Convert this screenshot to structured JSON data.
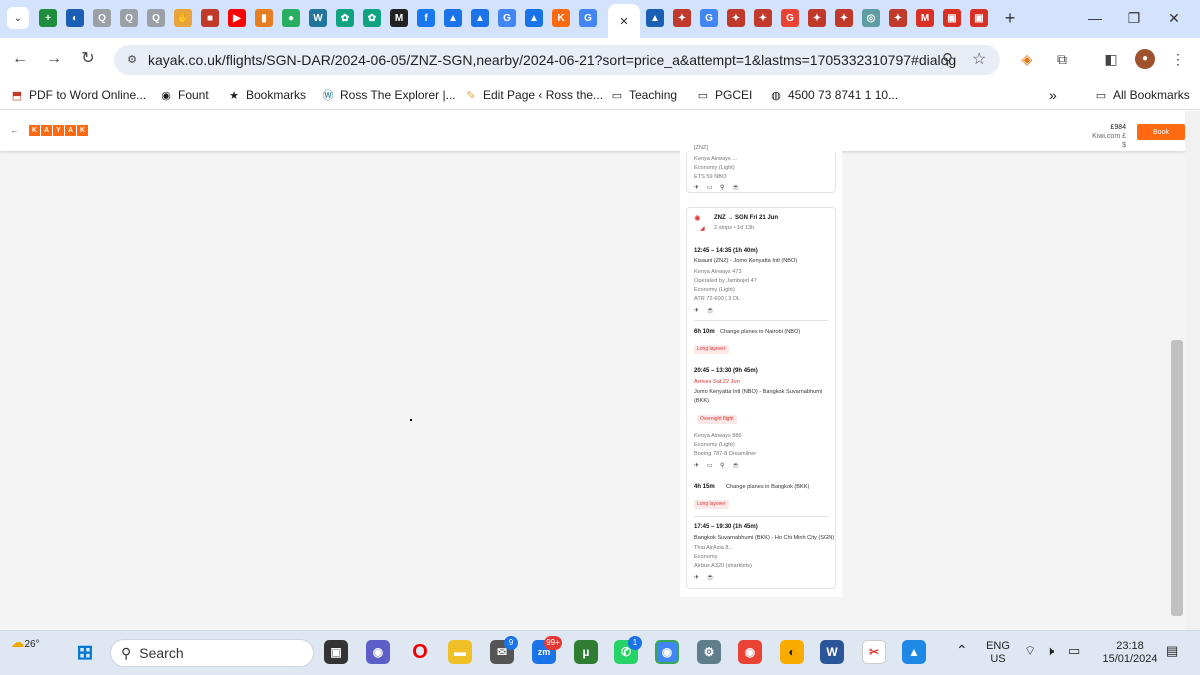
{
  "browser": {
    "active_tab_close": "×",
    "new_tab": "+",
    "url": "kayak.co.uk/flights/SGN-DAR/2024-06-05/ZNZ-SGN,nearby/2024-06-21?sort=price_a&attempt=1&lastms=1705332310797#dialog",
    "tabs": [
      {
        "icon": "sheets-icon",
        "color": "#1e8e3e",
        "glyph": "+"
      },
      {
        "icon": "globe-icon",
        "color": "#1a5fb4",
        "glyph": "◐"
      },
      {
        "icon": "search-icon",
        "color": "#9aa0a6",
        "glyph": "Q"
      },
      {
        "icon": "search-icon",
        "color": "#9aa0a6",
        "glyph": "Q"
      },
      {
        "icon": "search-icon",
        "color": "#9aa0a6",
        "glyph": "Q"
      },
      {
        "icon": "hand-icon",
        "color": "#e8a33d",
        "glyph": "✋"
      },
      {
        "icon": "clapper-icon",
        "color": "#c0392b",
        "glyph": "■"
      },
      {
        "icon": "youtube-icon",
        "color": "#ff0000",
        "glyph": "▶"
      },
      {
        "icon": "bookmark-icon",
        "color": "#e67e22",
        "glyph": "▮"
      },
      {
        "icon": "chat-icon",
        "color": "#27ae60",
        "glyph": "●"
      },
      {
        "icon": "wordpress-icon",
        "color": "#21759b",
        "glyph": "W"
      },
      {
        "icon": "openai-icon",
        "color": "#10a37f",
        "glyph": "✿"
      },
      {
        "icon": "openai-icon",
        "color": "#10a37f",
        "glyph": "✿"
      },
      {
        "icon": "mm-icon",
        "color": "#222222",
        "glyph": "M"
      },
      {
        "icon": "facebook-icon",
        "color": "#1877f2",
        "glyph": "f"
      },
      {
        "icon": "image-icon",
        "color": "#1a73e8",
        "glyph": "▲"
      },
      {
        "icon": "image-icon",
        "color": "#1a73e8",
        "glyph": "▲"
      },
      {
        "icon": "g-icon",
        "color": "#4285f4",
        "glyph": "G"
      },
      {
        "icon": "image-icon",
        "color": "#1a73e8",
        "glyph": "▲"
      },
      {
        "icon": "kayak-icon",
        "color": "#ff690f",
        "glyph": "K"
      },
      {
        "icon": "g-icon",
        "color": "#4285f4",
        "glyph": "G"
      }
    ],
    "tabs_right": [
      {
        "icon": "sail-icon",
        "color": "#1a5fb4",
        "glyph": "▲"
      },
      {
        "icon": "cluster-icon",
        "color": "#c0392b",
        "glyph": "✦"
      },
      {
        "icon": "g-icon",
        "color": "#4285f4",
        "glyph": "G"
      },
      {
        "icon": "cluster-icon",
        "color": "#c0392b",
        "glyph": "✦"
      },
      {
        "icon": "cluster-icon",
        "color": "#c0392b",
        "glyph": "✦"
      },
      {
        "icon": "google-icon",
        "color": "#ea4335",
        "glyph": "G"
      },
      {
        "icon": "cluster-icon",
        "color": "#c0392b",
        "glyph": "✦"
      },
      {
        "icon": "cluster-icon",
        "color": "#c0392b",
        "glyph": "✦"
      },
      {
        "icon": "spiral-icon",
        "color": "#5f9ea0",
        "glyph": "◎"
      },
      {
        "icon": "cluster-icon",
        "color": "#c0392b",
        "glyph": "✦"
      },
      {
        "icon": "gmail-icon",
        "color": "#d93025",
        "glyph": "M"
      },
      {
        "icon": "document-icon",
        "color": "#d93025",
        "glyph": "▣"
      },
      {
        "icon": "document-icon",
        "color": "#d93025",
        "glyph": "▣"
      }
    ],
    "bookmarks": [
      {
        "label": "PDF to Word Online...",
        "icon": "pdf-icon"
      },
      {
        "label": "Fount",
        "icon": "fount-icon"
      },
      {
        "label": "Bookmarks",
        "icon": "star-icon"
      },
      {
        "label": "Ross The Explorer |...",
        "icon": "wordpress-icon"
      },
      {
        "label": "Edit Page ‹ Ross the...",
        "icon": "pen-icon"
      },
      {
        "label": "Teaching",
        "icon": "folder-icon"
      },
      {
        "label": "PGCEI",
        "icon": "folder-icon"
      },
      {
        "label": "4500 73 8741 1 10...",
        "icon": "globe-icon"
      }
    ],
    "bookmarks_more": "»",
    "all_bookmarks": "All Bookmarks"
  },
  "kayak": {
    "price": "£984",
    "price_sub": "Kiwi.com £$",
    "book": "Book",
    "card": {
      "prev_lines": [
        "[ZNZ]",
        "Kenya Airways ...",
        "Economy (Light)",
        "ETS 59 NBO"
      ],
      "segment_title": "ZNZ → SGN  Fri 21 Jun",
      "segment_sub": "2 stops • 1d 13h",
      "leg1_time": "12:45 – 14:35 (1h 40m)",
      "leg1_route": "Kisauni (ZNZ) - Jomo Kenyatta Intl (NBO)",
      "leg1_airline": "Kenya Airways 473",
      "leg1_operated": "Operated by Jambojet 47",
      "leg1_class": "Economy (Light)",
      "leg1_aircraft": "ATR 72-600 | 3 DL",
      "layover1_dur": "6h 10m",
      "layover1_text": "Change planes in Nairobi (NBO)",
      "layover1_pill": "Long layover",
      "leg2_time": "20:45 – 13:30 (9h 45m)",
      "leg2_arrives": "Arrives Sat 22 Jun",
      "leg2_route": "Jomo Kenyatta Intl (NBO) - Bangkok Suvarnabhumi",
      "leg2_route2": "(BKK)",
      "leg2_pill": "Overnight flight",
      "leg2_airline": "Kenya Airways 886",
      "leg2_class": "Economy (Light)",
      "leg2_aircraft": "Boeing 787-8 Dreamliner",
      "layover2_dur": "4h 15m",
      "layover2_text": "Change planes in Bangkok (BKK)",
      "layover2_pill": "Long layover",
      "leg3_time": "17:45 – 19:30 (1h 45m)",
      "leg3_route": "Bangkok Suvarnabhumi (BKK) - Ho Chi Minh City (SGN)",
      "leg3_airline": "Thai AirAsia 8...",
      "leg3_class": "Economy",
      "leg3_aircraft": "Airbus A320 (sharklets)"
    }
  },
  "taskbar": {
    "weather_temp": "26°",
    "search_label": "Search",
    "lang_line1": "ENG",
    "lang_line2": "US",
    "time": "23:18",
    "date": "15/01/2024",
    "badge_mail": "9",
    "badge_chat": "99+",
    "badge_whatsapp": "1"
  }
}
